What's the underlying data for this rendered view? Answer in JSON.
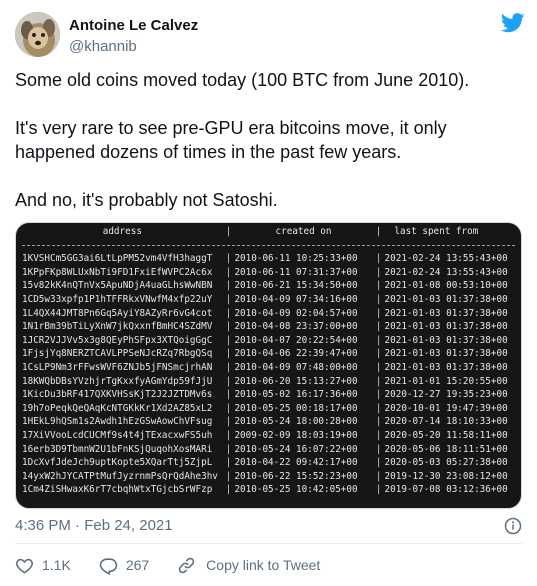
{
  "user": {
    "display_name": "Antoine Le Calvez",
    "handle": "@khannib"
  },
  "tweet": {
    "paragraphs": [
      "Some old coins moved today (100 BTC from June 2010).",
      "It's very rare to see pre-GPU era bitcoins move, it only happened dozens of times in the past few years.",
      "And no, it's probably not Satoshi."
    ]
  },
  "table": {
    "headers": {
      "address": "address",
      "created_on": "created on",
      "last_spent_from": "last spent from"
    },
    "rows": [
      {
        "address": "1KVSHCm5GG3ai6LtLpPM52vm4VfH3haggT",
        "created": "2010-06-11 10:25:33+00",
        "last": "2021-02-24 13:55:43+00"
      },
      {
        "address": "1KPpFKp8WLUxNbTi9FD1FxiEfWVPC2Ac6x",
        "created": "2010-06-11 07:31:37+00",
        "last": "2021-02-24 13:55:43+00"
      },
      {
        "address": "15v82kK4nQTnVx5ApuNDjA4uaGLhsWwNBN",
        "created": "2010-06-21 15:34:50+00",
        "last": "2021-01-08 00:53:10+00"
      },
      {
        "address": "1CD5w33xpfp1P1hTFFRkxVNwfM4xfp22uY",
        "created": "2010-04-09 07:34:16+00",
        "last": "2021-01-03 01:37:38+00"
      },
      {
        "address": "1L4QX44JMT8Pn6Gq5AyiY8AZyRr6vG4cot",
        "created": "2010-04-09 02:04:57+00",
        "last": "2021-01-03 01:37:38+00"
      },
      {
        "address": "1N1rBm39bTiLyXnW7jkQxxnfBmHC4SZdMV",
        "created": "2010-04-08 23:37:00+00",
        "last": "2021-01-03 01:37:38+00"
      },
      {
        "address": "1JCR2VJJVv5x3g8QEyPhSFpx3XTQoigGgC",
        "created": "2010-04-07 20:22:54+00",
        "last": "2021-01-03 01:37:38+00"
      },
      {
        "address": "1FjsjYq8NERZTCAVLPPSeNJcRZq7RbgQSq",
        "created": "2010-04-06 22:39:47+00",
        "last": "2021-01-03 01:37:38+00"
      },
      {
        "address": "1CsLP9Nm3rFFwsWVF6ZNJb5jFNSmcjrhAN",
        "created": "2010-04-09 07:48:00+00",
        "last": "2021-01-03 01:37:38+00"
      },
      {
        "address": "18KWQbDBsYVzhjrTgKxxfyAGmYdp59fJjU",
        "created": "2010-06-20 15:13:27+00",
        "last": "2021-01-01 15:20:55+00"
      },
      {
        "address": "1KicDu3bRF417QXKVHSsKjT2J2JZTDMv6s",
        "created": "2010-05-02 16:17:36+00",
        "last": "2020-12-27 19:35:23+00"
      },
      {
        "address": "19h7oPeqkQeQAqKcNTGKkKr1Xd2AZ85xL2",
        "created": "2010-05-25 00:18:17+00",
        "last": "2020-10-01 19:47:39+00"
      },
      {
        "address": "1HEkL9hQSm1s2Awdh1hEzGSwAowChVFsug",
        "created": "2010-05-24 18:00:28+00",
        "last": "2020-07-14 18:10:33+00"
      },
      {
        "address": "17XiVVooLcdCUCMf9s4t4jTExacxwFS5uh",
        "created": "2009-02-09 18:03:19+00",
        "last": "2020-05-20 11:58:11+00"
      },
      {
        "address": "16erb3D9TbmnW2U1bFnKSjQuqohXosMARi",
        "created": "2010-05-24 16:07:22+00",
        "last": "2020-05-06 18:11:51+00"
      },
      {
        "address": "1DcXvfJdeJch9uptKopte5XQarTtj5ZjpL",
        "created": "2010-04-22 09:42:17+00",
        "last": "2020-05-03 05:27:38+00"
      },
      {
        "address": "14yxW2hJYCATPtMufJyzrnmPsQrQdAhe3hv",
        "created": "2010-06-22 15:52:23+00",
        "last": "2019-12-30 23:08:12+00"
      },
      {
        "address": "1Cm4ZiSHwaxK6rT7cbqhWtxTGjcbSrWFzp",
        "created": "2010-05-25 10:42:05+00",
        "last": "2019-07-08 03:12:36+00"
      }
    ],
    "separator": "|"
  },
  "meta": {
    "timestamp": "4:36 PM · Feb 24, 2021"
  },
  "actions": {
    "likes": "1.1K",
    "replies": "267",
    "copy_link": "Copy link to Tweet"
  },
  "colors": {
    "twitter_blue": "#1da1f2",
    "like_icon": "#5b7083",
    "text_secondary": "#5b7083"
  },
  "icons": [
    "twitter-logo-icon",
    "info-icon",
    "heart-icon",
    "reply-icon",
    "link-icon"
  ]
}
